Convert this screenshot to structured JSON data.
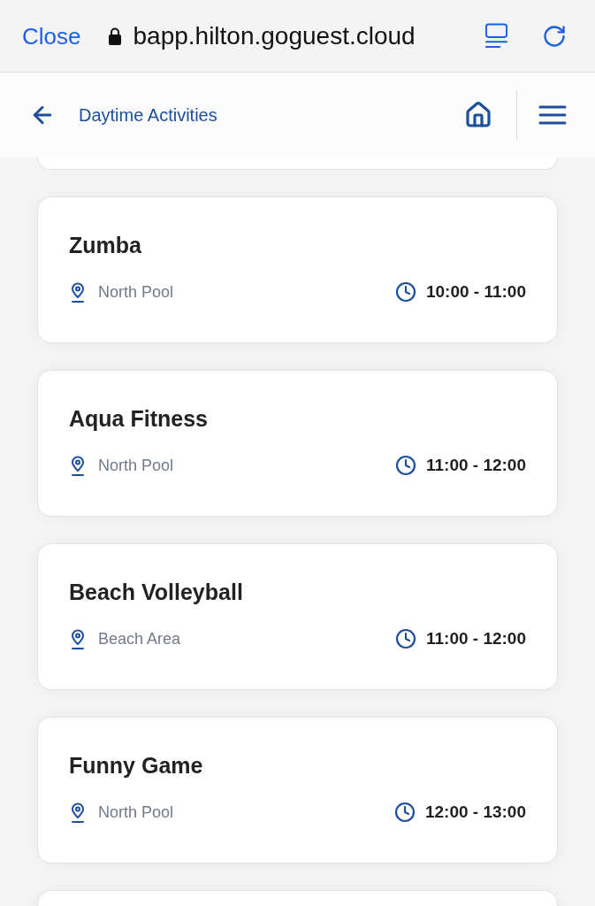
{
  "browser": {
    "close": "Close",
    "url": "bapp.hilton.goguest.cloud"
  },
  "header": {
    "title": "Daytime Activities"
  },
  "activities": [
    {
      "title": "Zumba",
      "location": "North Pool",
      "time": "10:00 - 11:00"
    },
    {
      "title": "Aqua Fitness",
      "location": "North Pool",
      "time": "11:00 - 12:00"
    },
    {
      "title": "Beach Volleyball",
      "location": "Beach Area",
      "time": "11:00 - 12:00"
    },
    {
      "title": "Funny Game",
      "location": "North Pool",
      "time": "12:00 - 13:00"
    }
  ]
}
